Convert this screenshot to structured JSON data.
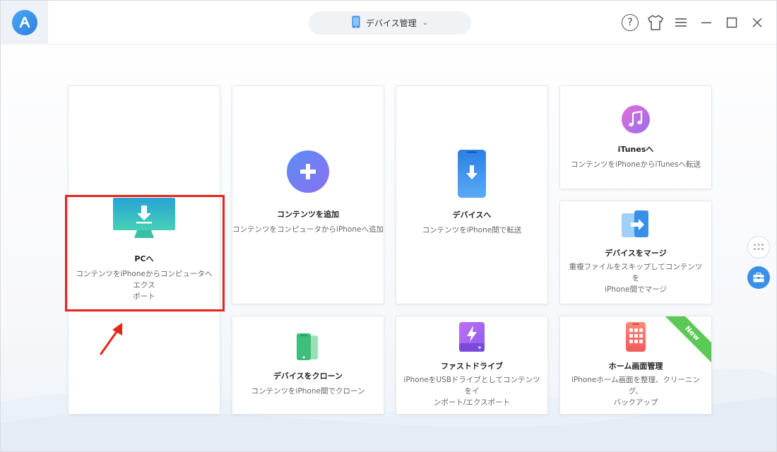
{
  "header": {
    "device_selector_label": "デバイス管理",
    "help_label": "?"
  },
  "cards": {
    "to_pc": {
      "title": "PCへ",
      "desc": "コンテンツをiPhoneからコンピュータへエクスポート",
      "desc_line1": "コンテンツをiPhoneからコンピュータへエクス",
      "desc_line2": "ポート"
    },
    "add_content": {
      "title": "コンテンツを追加",
      "desc": "コンテンツをコンピュータからiPhoneへ追加"
    },
    "to_device": {
      "title": "デバイスへ",
      "desc": "コンテンツをiPhone間で転送"
    },
    "to_itunes": {
      "title": "iTunesへ",
      "desc": "コンテンツをiPhoneからiTunesへ転送"
    },
    "merge_device": {
      "title": "デバイスをマージ",
      "desc_line1": "重複ファイルをスキップしてコンテンツを",
      "desc_line2": "iPhone間でマージ"
    },
    "clone_device": {
      "title": "デバイスをクローン",
      "desc": "コンテンツをiPhone間でクローン"
    },
    "fast_drive": {
      "title": "ファストドライブ",
      "desc_line1": "iPhoneをUSBドライブとしてコンテンツをイ",
      "desc_line2": "ンポート/エクスポート"
    },
    "home_screen": {
      "title": "ホーム画面管理",
      "desc_line1": "iPhoneホーム画面を整理、クリーニング、",
      "desc_line2": "バックアップ",
      "badge": "New"
    }
  },
  "colors": {
    "accent_blue": "#3a8fe8",
    "highlight_red": "#e8231a",
    "new_badge_green": "#5cc957"
  },
  "icons": {
    "app_logo": "anytrans-logo-icon",
    "device": "phone-icon",
    "help": "help-circle-icon",
    "skin": "tshirt-icon",
    "menu": "hamburger-menu-icon",
    "minimize": "minimize-icon",
    "maximize": "maximize-icon",
    "close": "close-icon",
    "side_grid": "grid-icon",
    "side_toolbox": "toolbox-icon"
  }
}
